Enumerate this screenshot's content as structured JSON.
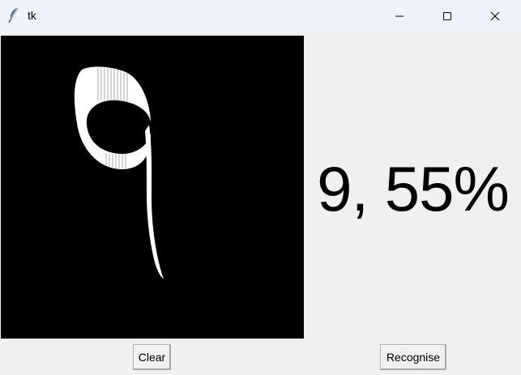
{
  "window": {
    "title": "tk",
    "app_icon": "feather-icon",
    "controls": {
      "minimize_icon": "minimize-icon",
      "maximize_icon": "maximize-icon",
      "close_icon": "close-icon"
    }
  },
  "drawing_canvas": {
    "background_color": "#000000",
    "stroke_color": "#ffffff",
    "drawn_digit_icon": "handwritten-digit-nine"
  },
  "result": {
    "text": "9, 55%"
  },
  "buttons": {
    "clear_label": "Clear",
    "recognise_label": "Recognise"
  }
}
